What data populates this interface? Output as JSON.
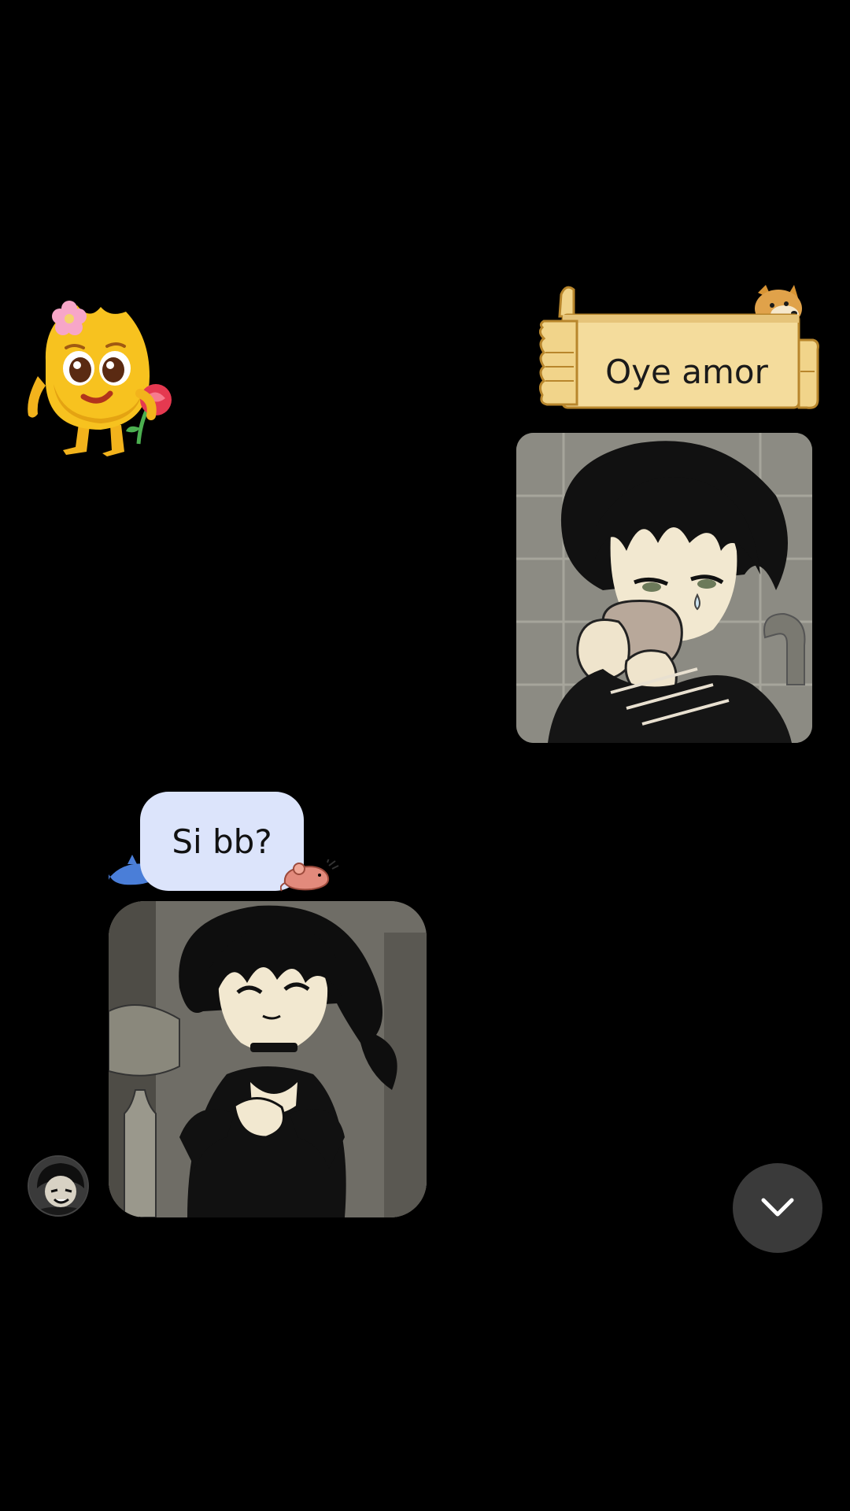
{
  "conversation": {
    "outgoing_message": {
      "text": "Oye amor",
      "bubble_style": "wooden-sign-with-dog",
      "bubble_color": "#f4dc9c"
    },
    "outgoing_image": {
      "description_icon": "anime-boy-drinking-image"
    },
    "incoming_message": {
      "text": "Si bb?",
      "bubble_color": "#dce4fb"
    },
    "incoming_image": {
      "description_icon": "anime-girl-happy-image"
    }
  },
  "stickers": {
    "left_sticker": "yellow-flame-character-with-rose"
  },
  "controls": {
    "scroll_down_icon": "chevron-down-icon"
  },
  "colors": {
    "background": "#000000",
    "scroll_button": "#3a3a3a"
  }
}
